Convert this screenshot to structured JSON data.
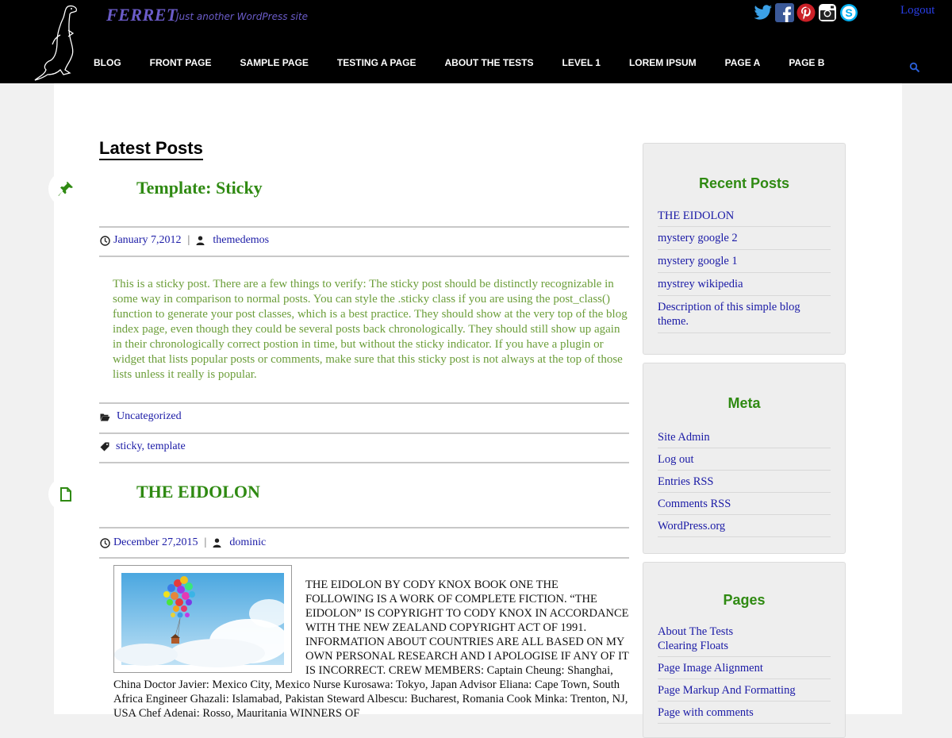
{
  "site": {
    "title": "FERRET",
    "tagline": "Just another WordPress site",
    "logout": "Logout"
  },
  "nav": [
    "BLOG",
    "FRONT PAGE",
    "SAMPLE PAGE",
    "TESTING A PAGE",
    "ABOUT THE TESTS",
    "LEVEL 1",
    "LOREM IPSUM",
    "PAGE A",
    "PAGE B"
  ],
  "social_icons": [
    "twitter-icon",
    "facebook-icon",
    "pinterest-icon",
    "instagram-icon",
    "skype-icon"
  ],
  "colors": {
    "accent_green": "#2f8a12",
    "link_blue": "#1a1aa6",
    "header_bg": "#000000",
    "sticky_text": "#6c9e3a"
  },
  "main": {
    "heading": "Latest Posts",
    "posts": [
      {
        "title": "Template: Sticky",
        "date": "January 7,2012",
        "author": "themedemos",
        "body": "This is a sticky post. There are a few things to verify: The sticky post should be distinctly recognizable in some way in comparison to normal posts. You can style the .sticky class if you are using the post_class() function to generate your post classes, which is a best practice. They should show at the very top of the blog index page, even though they could be several posts back chronologically. They should still show up again in their chronologically correct postion in time, but without the sticky indicator. If you have a plugin or widget that lists popular posts or comments, make sure that this sticky post is not always at the top of those lists unless it really is popular.",
        "category": "Uncategorized",
        "tags": "sticky, template"
      },
      {
        "title": "THE EIDOLON",
        "date": "December 27,2015",
        "author": "dominic",
        "body": "THE EIDOLON BY CODY KNOX BOOK ONE THE FOLLOWING IS A WORK OF COMPLETE FICTION. “THE EIDOLON” IS COPYRIGHT TO CODY KNOX IN ACCORDANCE WITH THE NEW ZEALAND COPYRIGHT ACT OF 1991. INFORMATION ABOUT COUNTRIES ARE ALL BASED ON MY OWN PERSONAL RESEARCH AND I APOLOGISE IF ANY OF IT IS INCORRECT. CREW MEMBERS: Captain Cheung: Shanghai, China Doctor Javier: Mexico City, Mexico Nurse Kurosawa: Tokyo, Japan Advisor Eliana: Cape Town, South Africa Engineer Ghazali: Islamabad, Pakistan Steward Albescu: Bucharest, Romania Cook Minka: Trenton, NJ, USA Chef Adenai: Rosso, Mauritania WINNERS OF"
      }
    ]
  },
  "sidebar": {
    "recent": {
      "title": "Recent Posts",
      "items": [
        "THE EIDOLON",
        "mystery google 2",
        "mystery google 1",
        "mystrey wikipedia",
        "Description of this simple blog theme."
      ]
    },
    "meta": {
      "title": "Meta",
      "items": [
        "Site Admin",
        "Log out",
        "Entries RSS",
        "Comments RSS",
        "WordPress.org"
      ]
    },
    "pages": {
      "title": "Pages",
      "items": [
        "About The Tests",
        "Clearing Floats",
        "Page Image Alignment",
        "Page Markup And Formatting",
        "Page with comments"
      ]
    }
  }
}
